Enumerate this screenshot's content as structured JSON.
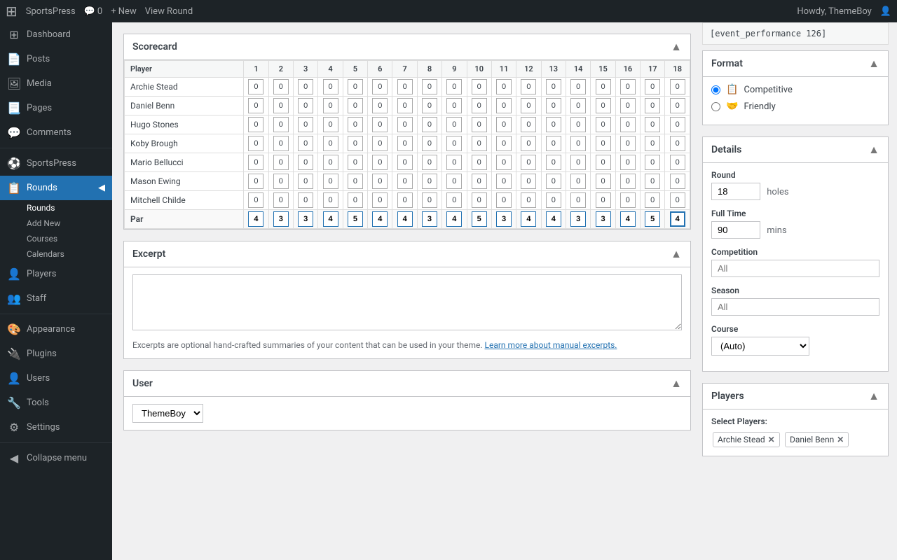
{
  "topbar": {
    "wp_logo": "⊞",
    "site_name": "SportsPress",
    "new_label": "+ New",
    "view_round_label": "View Round",
    "comments_label": "0",
    "howdy_label": "Howdy, ThemeBoy"
  },
  "sidebar": {
    "items": [
      {
        "id": "dashboard",
        "icon": "⊞",
        "label": "Dashboard"
      },
      {
        "id": "posts",
        "icon": "📄",
        "label": "Posts"
      },
      {
        "id": "media",
        "icon": "🖼",
        "label": "Media"
      },
      {
        "id": "pages",
        "icon": "📃",
        "label": "Pages"
      },
      {
        "id": "comments",
        "icon": "💬",
        "label": "Comments"
      },
      {
        "id": "sportspress",
        "icon": "⚽",
        "label": "SportsPress"
      },
      {
        "id": "rounds",
        "icon": "📋",
        "label": "Rounds",
        "active": true
      },
      {
        "id": "players",
        "icon": "👤",
        "label": "Players"
      },
      {
        "id": "staff",
        "icon": "👥",
        "label": "Staff"
      },
      {
        "id": "appearance",
        "icon": "🎨",
        "label": "Appearance"
      },
      {
        "id": "plugins",
        "icon": "🔌",
        "label": "Plugins"
      },
      {
        "id": "users",
        "icon": "👤",
        "label": "Users"
      },
      {
        "id": "tools",
        "icon": "🔧",
        "label": "Tools"
      },
      {
        "id": "settings",
        "icon": "⚙",
        "label": "Settings"
      },
      {
        "id": "collapse",
        "icon": "◀",
        "label": "Collapse menu"
      }
    ],
    "subitems": [
      {
        "id": "rounds-main",
        "label": "Rounds",
        "active": true
      },
      {
        "id": "add-new",
        "label": "Add New"
      },
      {
        "id": "courses",
        "label": "Courses"
      },
      {
        "id": "calendars",
        "label": "Calendars"
      }
    ]
  },
  "scorecard": {
    "title": "Scorecard",
    "columns": [
      "Player",
      "1",
      "2",
      "3",
      "4",
      "5",
      "6",
      "7",
      "8",
      "9",
      "10",
      "11",
      "12",
      "13",
      "14",
      "15",
      "16",
      "17",
      "18"
    ],
    "players": [
      {
        "name": "Archie Stead",
        "scores": [
          0,
          0,
          0,
          0,
          0,
          0,
          0,
          0,
          0,
          0,
          0,
          0,
          0,
          0,
          0,
          0,
          0,
          0
        ]
      },
      {
        "name": "Daniel Benn",
        "scores": [
          0,
          0,
          0,
          0,
          0,
          0,
          0,
          0,
          0,
          0,
          0,
          0,
          0,
          0,
          0,
          0,
          0,
          0
        ]
      },
      {
        "name": "Hugo Stones",
        "scores": [
          0,
          0,
          0,
          0,
          0,
          0,
          0,
          0,
          0,
          0,
          0,
          0,
          0,
          0,
          0,
          0,
          0,
          0
        ]
      },
      {
        "name": "Koby Brough",
        "scores": [
          0,
          0,
          0,
          0,
          0,
          0,
          0,
          0,
          0,
          0,
          0,
          0,
          0,
          0,
          0,
          0,
          0,
          0
        ]
      },
      {
        "name": "Mario Bellucci",
        "scores": [
          0,
          0,
          0,
          0,
          0,
          0,
          0,
          0,
          0,
          0,
          0,
          0,
          0,
          0,
          0,
          0,
          0,
          0
        ]
      },
      {
        "name": "Mason Ewing",
        "scores": [
          0,
          0,
          0,
          0,
          0,
          0,
          0,
          0,
          0,
          0,
          0,
          0,
          0,
          0,
          0,
          0,
          0,
          0
        ]
      },
      {
        "name": "Mitchell Childe",
        "scores": [
          0,
          0,
          0,
          0,
          0,
          0,
          0,
          0,
          0,
          0,
          0,
          0,
          0,
          0,
          0,
          0,
          0,
          0
        ]
      }
    ],
    "par_label": "Par",
    "par_values": [
      4,
      3,
      3,
      4,
      5,
      4,
      4,
      3,
      4,
      5,
      3,
      4,
      4,
      3,
      3,
      4,
      5,
      4
    ]
  },
  "excerpt": {
    "title": "Excerpt",
    "placeholder": "",
    "note": "Excerpts are optional hand-crafted summaries of your content that can be used in your theme.",
    "link_text": "Learn more about manual excerpts.",
    "link_url": "#"
  },
  "user": {
    "title": "User",
    "selected": "ThemeBoy"
  },
  "right_panel": {
    "shortcode": "[event_performance 126]",
    "format": {
      "title": "Format",
      "options": [
        {
          "id": "competitive",
          "label": "Competitive",
          "checked": true
        },
        {
          "id": "friendly",
          "label": "Friendly",
          "checked": false
        }
      ]
    },
    "details": {
      "title": "Details",
      "round_label": "Round",
      "round_value": "18",
      "round_unit": "holes",
      "fulltime_label": "Full Time",
      "fulltime_value": "90",
      "fulltime_unit": "mins",
      "competition_label": "Competition",
      "competition_placeholder": "All",
      "season_label": "Season",
      "season_placeholder": "All",
      "course_label": "Course",
      "course_value": "(Auto)"
    },
    "players": {
      "title": "Players",
      "select_label": "Select Players:",
      "tags": [
        {
          "name": "Archie Stead"
        },
        {
          "name": "Daniel Benn"
        }
      ]
    }
  }
}
